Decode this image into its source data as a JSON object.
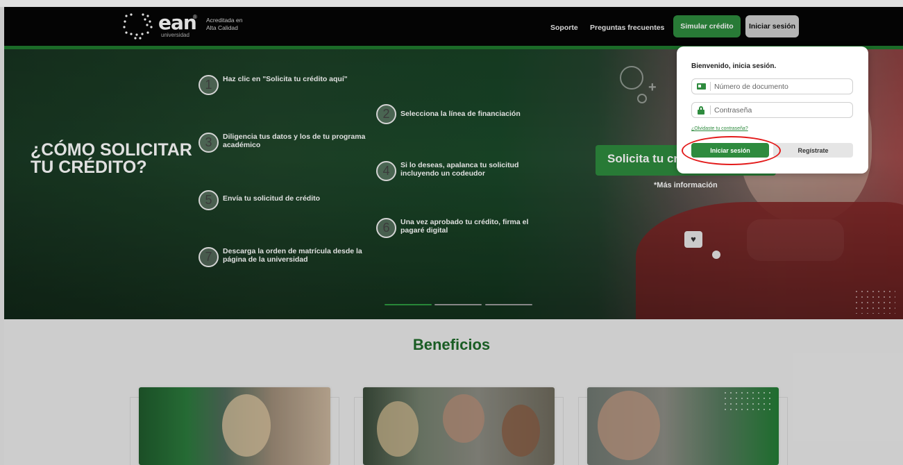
{
  "header": {
    "logo_word": "ean",
    "logo_reg": "®",
    "logo_sub": "universidad",
    "accreditation_line1": "Acreditada en",
    "accreditation_line2": "Alta Calidad",
    "nav": {
      "soporte": "Soporte",
      "faq": "Preguntas frecuentes",
      "simular": "Simular crédito",
      "iniciar": "Iniciar sesión"
    }
  },
  "hero": {
    "title_line1": "¿CÓMO SOLICITAR",
    "title_line2": "TU CRÉDITO?",
    "steps": [
      {
        "num": "1",
        "text": "Haz clic en \"Solicita tu crédito aquí\""
      },
      {
        "num": "2",
        "text": "Selecciona la línea de financiación"
      },
      {
        "num": "3",
        "text": "Diligencia tus datos y los de tu programa académico"
      },
      {
        "num": "4",
        "text": "Si lo deseas, apalanca tu solicitud incluyendo un codeudor"
      },
      {
        "num": "5",
        "text": "Envía tu solicitud de crédito"
      },
      {
        "num": "6",
        "text": "Una vez aprobado tu crédito, firma el pagaré digital"
      },
      {
        "num": "7",
        "text": "Descarga la orden de matrícula desde la página de la universidad"
      }
    ],
    "cta_label": "Solicita tu crédito aquí",
    "more_info": "*Más información",
    "slides_total": 3,
    "slide_active": 1
  },
  "beneficios": {
    "title": "Beneficios"
  },
  "login": {
    "title": "Bienvenido, inicia sesión.",
    "doc_placeholder": "Número de documento",
    "pass_placeholder": "Contraseña",
    "forgot": "¿Olvidaste tu contraseña?",
    "login_button": "Iniciar sesión",
    "register_button": "Regístrate"
  },
  "colors": {
    "brand_green": "#2e8b3e",
    "highlight_red": "#e31b1b",
    "header_bg": "#050505"
  },
  "icons": [
    "id-card-icon",
    "lock-icon",
    "heart-chat-icon",
    "location-pin-icon"
  ]
}
